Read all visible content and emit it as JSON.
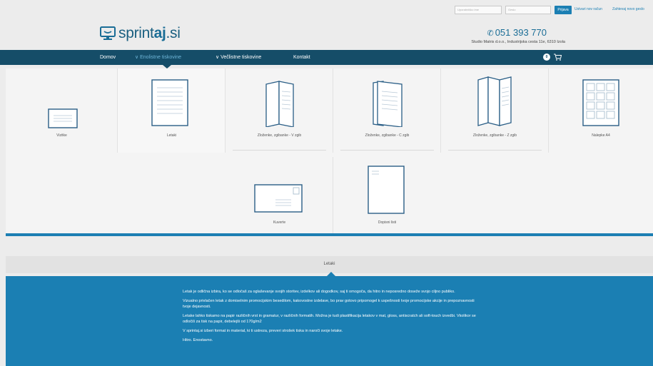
{
  "login": {
    "email_placeholder": "Uporabniško ime",
    "password_placeholder": "Geslo",
    "login_label": "Prijava",
    "register_label": "Ustvari nov račun",
    "forgot_label": "Zahtevaj novo geslo"
  },
  "header": {
    "logo_pre": "sprint",
    "logo_bold": "aj",
    "logo_post": ".si",
    "phone": "051 393 770",
    "address": "Studio Matris d.o.o., Industrijska cesta 11e, 6310 Izola"
  },
  "nav": {
    "items": [
      {
        "label": "Domov"
      },
      {
        "label": "Enolistne tiskovine"
      },
      {
        "label": "Večlistne tiskovine"
      },
      {
        "label": "Kontakt"
      }
    ],
    "cart_count": "0"
  },
  "products": [
    {
      "label": "Vizitke",
      "icon": "business-card-icon"
    },
    {
      "label": "Letaki",
      "icon": "flyer-icon"
    },
    {
      "label": "Zloženke, zgibanke - V zgib",
      "icon": "v-fold-icon"
    },
    {
      "label": "Zloženke, zgibanke - C zgib",
      "icon": "c-fold-icon"
    },
    {
      "label": "Zloženke, zgibanke - Z zgib",
      "icon": "z-fold-icon"
    },
    {
      "label": "Nalepke A4",
      "icon": "sticker-sheet-icon"
    },
    {
      "label": "Kuverte",
      "icon": "envelope-icon"
    },
    {
      "label": "Dopisni listi",
      "icon": "letterhead-icon"
    }
  ],
  "section": {
    "title": "Letaki",
    "paragraphs": [
      "Letak je odlična izbira, ko se odločaš za oglaševanje svojih storitev, izdelkov ali dogodkov, saj ti omogoča, da hitro in neposredno doseže svojo ciljno publiko.",
      "Vizualno privlačen letak z domiselnim promocijskim besedilom, kakovostne izdelave, bo prav gotovo pripomogel k uspešnosti tvoje promocijske akcije in prepoznavnosti tvoje dejavnosti.",
      "Letake lahko tiskamo na papir različnih vrst in gramatur, v različnih formatih. Možna je tudi plastifikacija letakov v mat, gloss, antiscratch ali soft-touch izvedbi. Vkolikor se odločiš za tisk na papir, debelejši od 170g/m2",
      "V sprintaj.si izberi format in material, ki ti ustreza, preveri strošek tiska in naroči svoje letake.",
      "Hitro. Enostavno."
    ]
  },
  "colors": {
    "nav_bg": "#154d68",
    "accent": "#1b7fb3",
    "active_nav": "#6fb6d8"
  }
}
